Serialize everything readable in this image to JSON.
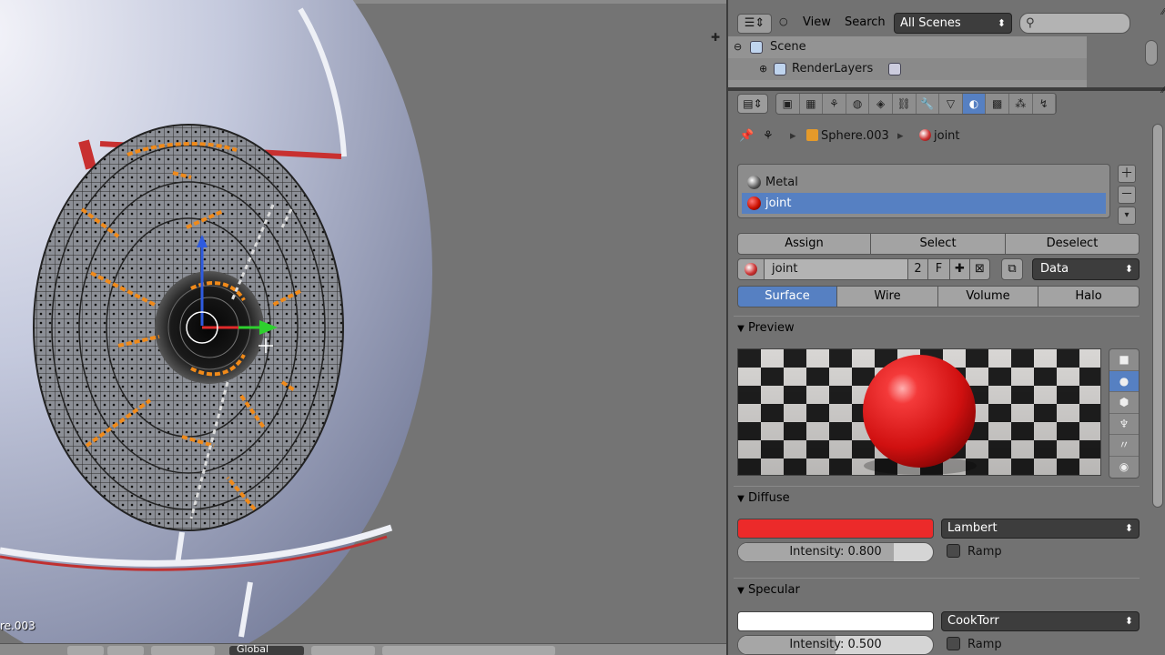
{
  "viewport": {
    "object_name": "re.003",
    "header_mode": "Global"
  },
  "outliner": {
    "editor_icon": "outliner-icon",
    "menu_view": "View",
    "menu_search": "Search",
    "scene_filter": "All Scenes",
    "tree": [
      {
        "label": "Scene",
        "icon": "scene-icon"
      },
      {
        "label": "RenderLayers",
        "icon": "render-layers-icon"
      }
    ]
  },
  "properties": {
    "context_tabs": [
      "render-icon",
      "render-layers-icon",
      "scene-icon",
      "world-icon",
      "object-icon",
      "constraints-icon",
      "modifiers-icon",
      "data-icon",
      "material-icon",
      "texture-icon",
      "particles-icon",
      "physics-icon"
    ],
    "active_tab": "material-icon",
    "breadcrumb": {
      "object": "Sphere.003",
      "material": "joint"
    },
    "slots": [
      {
        "name": "Metal",
        "color": "#3a3a3a",
        "selected": false
      },
      {
        "name": "joint",
        "color": "#c81010",
        "selected": true
      }
    ],
    "slot_buttons": {
      "assign": "Assign",
      "select": "Select",
      "deselect": "Deselect"
    },
    "material": {
      "name": "joint",
      "users": "2",
      "fake_user": "F",
      "link": "Data"
    },
    "type_tabs": [
      {
        "label": "Surface",
        "active": true
      },
      {
        "label": "Wire",
        "active": false
      },
      {
        "label": "Volume",
        "active": false
      },
      {
        "label": "Halo",
        "active": false
      }
    ],
    "preview": {
      "title": "Preview"
    },
    "diffuse": {
      "title": "Diffuse",
      "color": "#ec2a2a",
      "shader": "Lambert",
      "intensity_label": "Intensity: 0.800",
      "intensity": 0.8,
      "ramp": "Ramp"
    },
    "specular": {
      "title": "Specular",
      "color": "#ffffff",
      "shader": "CookTorr",
      "intensity_label": "Intensity: 0.500",
      "intensity": 0.5,
      "ramp": "Ramp"
    }
  }
}
